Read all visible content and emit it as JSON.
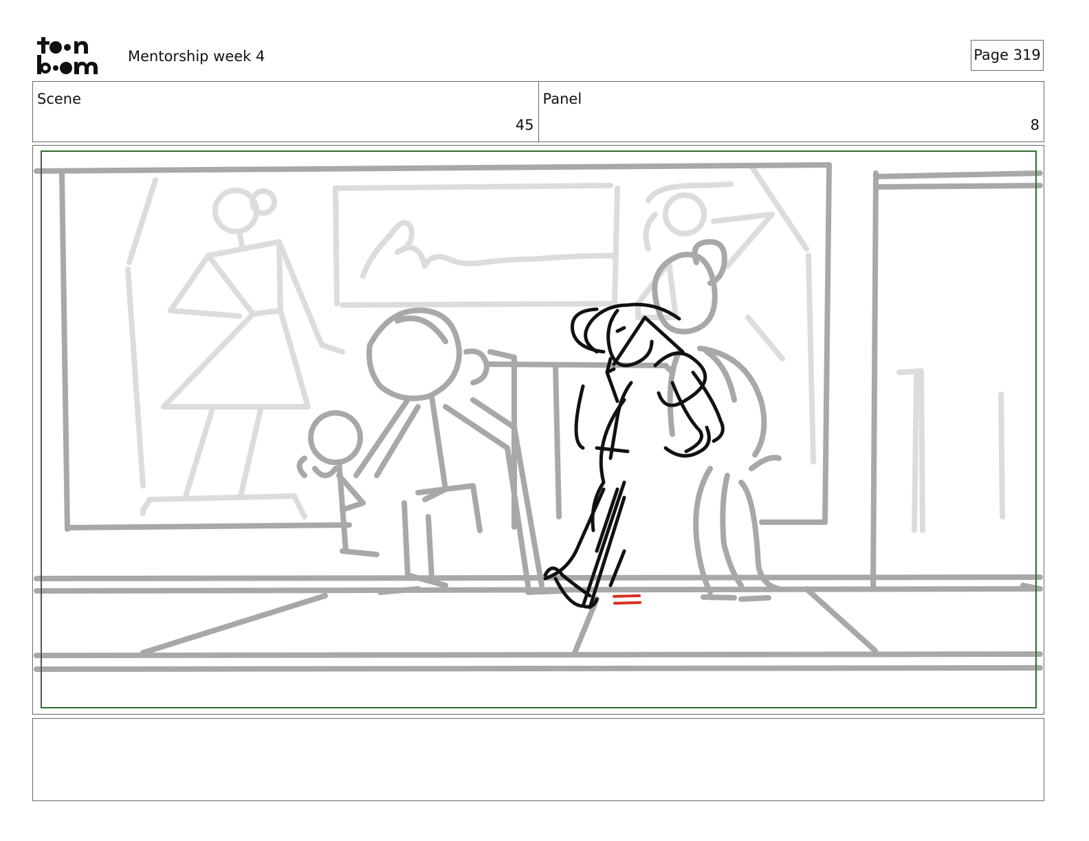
{
  "header": {
    "logo_text": "toon boom",
    "title": "Mentorship week 4",
    "page_label": "Page 319"
  },
  "info": {
    "scene_label": "Scene",
    "scene_value": "45",
    "panel_label": "Panel",
    "panel_value": "8"
  },
  "notes": {
    "text": ""
  },
  "colors": {
    "frame_border": "#666666",
    "safe_frame": "#2e6b2e",
    "sketch_light": "#d9d9d9",
    "sketch_mid": "#a6a6a6",
    "sketch_ink": "#111111",
    "accent_mark": "#d6301e"
  }
}
